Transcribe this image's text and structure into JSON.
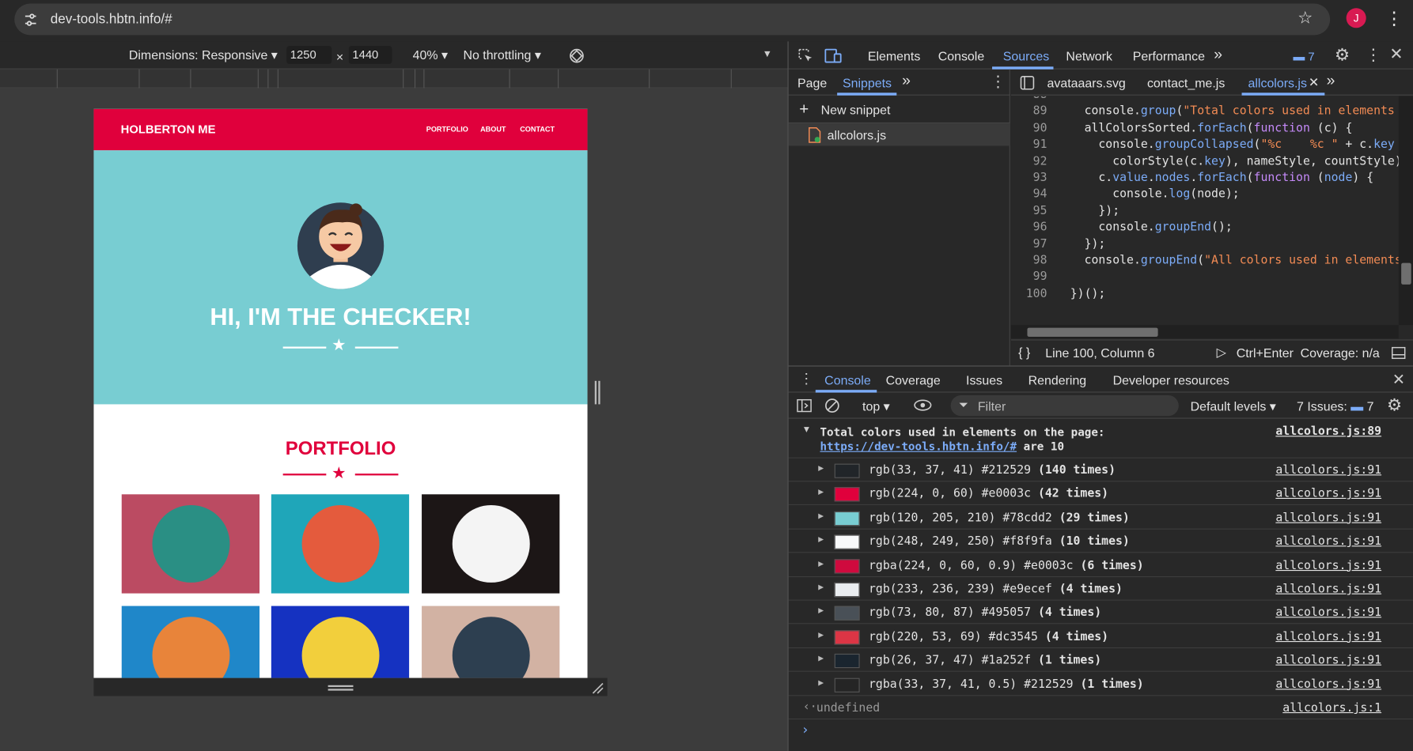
{
  "browser": {
    "url": "dev-tools.hbtn.info/#",
    "avatar_letter": "J"
  },
  "device_toolbar": {
    "dimensions": "Dimensions: Responsive ▾",
    "width": "1250",
    "times": "×",
    "height": "1440",
    "zoom": "40% ▾",
    "throttling": "No throttling ▾"
  },
  "site": {
    "brand": "HOLBERTON ME",
    "nav": [
      "PORTFOLIO",
      "ABOUT",
      "CONTACT"
    ],
    "hero_title": "HI, I'M THE CHECKER!",
    "portfolio_title": "PORTFOLIO",
    "colors": {
      "primary": "#e0003c",
      "hero": "#78cdd2",
      "dark": "#212529"
    },
    "tiles": [
      {
        "bg": "#bb4b62",
        "icon": "cabin-icon"
      },
      {
        "bg": "#1fa6b9",
        "icon": "cake-icon"
      },
      {
        "bg": "#1c1616",
        "icon": "circus-tent-icon"
      },
      {
        "bg": "#1f87c9",
        "icon": "game-controller-icon"
      },
      {
        "bg": "#1532c1",
        "icon": "safe-icon"
      },
      {
        "bg": "#d2b2a3",
        "icon": "submarine-icon"
      }
    ]
  },
  "devtools": {
    "main_tabs": [
      "Elements",
      "Console",
      "Sources",
      "Network",
      "Performance"
    ],
    "active_main_tab": "Sources",
    "issue_badge": "7",
    "navigator_tabs": [
      "Page",
      "Snippets"
    ],
    "new_snippet": "New snippet",
    "snippet_file": "allcolors.js",
    "editor_tabs": [
      "avataaars.svg",
      "contact_me.js",
      "allcolors.js"
    ],
    "code": [
      {
        "n": "88",
        "html": ""
      },
      {
        "n": "89",
        "html": "    console.<span class='prop'>group</span>(<span class='str'>\"Total colors used in elements on t</span>"
      },
      {
        "n": "90",
        "html": "    allColorsSorted.<span class='prop'>forEach</span>(<span class='kw'>function</span> (c) {"
      },
      {
        "n": "91",
        "html": "      console.<span class='prop'>groupCollapsed</span>(<span class='str'>\"%c    %c \"</span> + c.<span class='prop'>key</span> + <span class='str'>\"</span>"
      },
      {
        "n": "92",
        "html": "        colorStyle(c.<span class='prop'>key</span>), nameStyle, countStyle);"
      },
      {
        "n": "93",
        "html": "      c.<span class='prop'>value</span>.<span class='prop'>nodes</span>.<span class='prop'>forEach</span>(<span class='kw'>function</span> (<span class='prop'>node</span>) {"
      },
      {
        "n": "94",
        "html": "        console.<span class='prop'>log</span>(node);"
      },
      {
        "n": "95",
        "html": "      });"
      },
      {
        "n": "96",
        "html": "      console.<span class='prop'>groupEnd</span>();"
      },
      {
        "n": "97",
        "html": "    });"
      },
      {
        "n": "98",
        "html": "    console.<span class='prop'>groupEnd</span>(<span class='str'>\"All colors used in elements on</span>"
      },
      {
        "n": "99",
        "html": ""
      },
      {
        "n": "100",
        "html": "  })();"
      }
    ],
    "status": {
      "braces": "{ }",
      "position": "Line 100, Column 6",
      "run": "Ctrl+Enter",
      "coverage": "Coverage: n/a"
    },
    "drawer_tabs": [
      "Console",
      "Coverage",
      "Issues",
      "Rendering",
      "Developer resources"
    ],
    "console_toolbar": {
      "context": "top ▾",
      "filter_placeholder": "Filter",
      "levels": "Default levels ▾",
      "issues": "7 Issues:",
      "issues_count": "7"
    },
    "group_header_line1": "Total colors used in elements on the page:",
    "group_header_link": "https://dev-tools.hbtn.info/#",
    "group_header_tail": " are 10",
    "group_header_src": "allcolors.js:89",
    "rows": [
      {
        "swatch": "#212529",
        "text": "rgb(33, 37, 41) #212529 ",
        "count": "(140 times)",
        "src": "allcolors.js:91"
      },
      {
        "swatch": "#e0003c",
        "text": "rgb(224, 0, 60) #e0003c ",
        "count": "(42 times)",
        "src": "allcolors.js:91"
      },
      {
        "swatch": "#78cdd2",
        "text": "rgb(120, 205, 210) #78cdd2 ",
        "count": "(29 times)",
        "src": "allcolors.js:91"
      },
      {
        "swatch": "#f8f9fa",
        "text": "rgb(248, 249, 250) #f8f9fa ",
        "count": "(10 times)",
        "src": "allcolors.js:91"
      },
      {
        "swatch": "#cf0a3e",
        "text": "rgba(224, 0, 60, 0.9) #e0003c ",
        "count": "(6 times)",
        "src": "allcolors.js:91"
      },
      {
        "swatch": "#e9ecef",
        "text": "rgb(233, 236, 239) #e9ecef ",
        "count": "(4 times)",
        "src": "allcolors.js:91"
      },
      {
        "swatch": "#495057",
        "text": "rgb(73, 80, 87) #495057 ",
        "count": "(4 times)",
        "src": "allcolors.js:91"
      },
      {
        "swatch": "#dc3545",
        "text": "rgb(220, 53, 69) #dc3545 ",
        "count": "(4 times)",
        "src": "allcolors.js:91"
      },
      {
        "swatch": "#1a252f",
        "text": "rgb(26, 37, 47) #1a252f ",
        "count": "(1 times)",
        "src": "allcolors.js:91"
      },
      {
        "swatch": "#252525",
        "text": "rgba(33, 37, 41, 0.5) #212529 ",
        "count": "(1 times)",
        "src": "allcolors.js:91"
      }
    ],
    "result": "undefined",
    "result_src": "allcolors.js:1"
  }
}
